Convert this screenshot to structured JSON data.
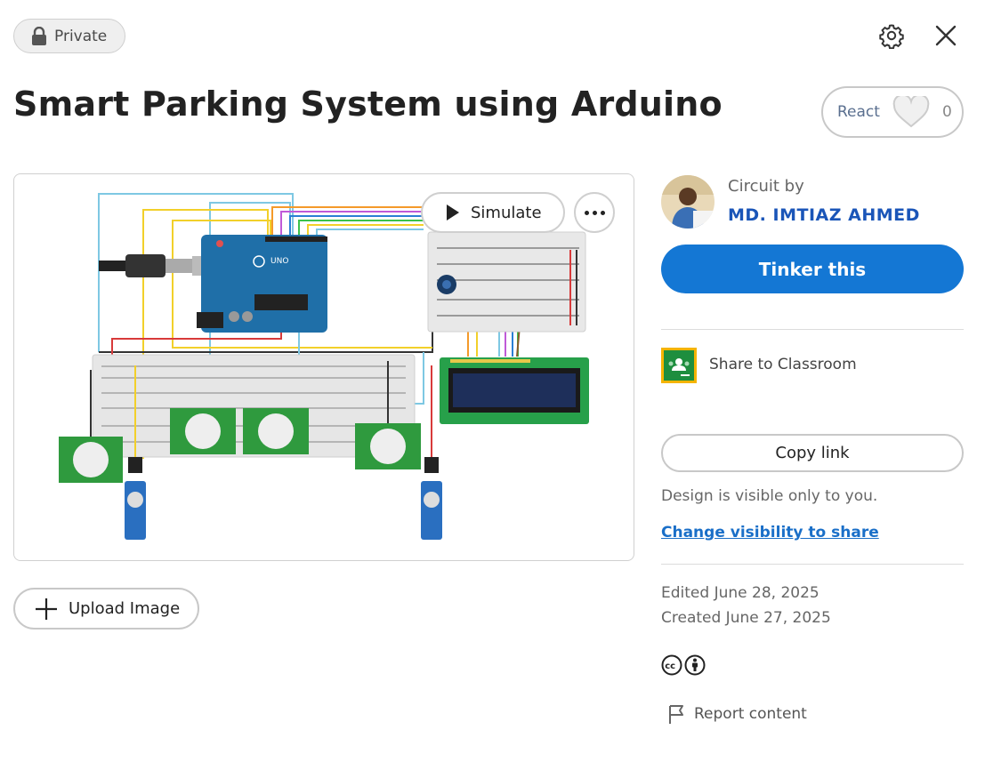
{
  "header": {
    "visibility_label": "Private",
    "title": "Smart Parking System using Arduino"
  },
  "reactions": {
    "label": "React",
    "count": "0"
  },
  "preview": {
    "simulate_label": "Simulate"
  },
  "upload": {
    "label": "Upload Image"
  },
  "sidebar": {
    "circuit_by_label": "Circuit by",
    "author_name": "MD. IMTIAZ AHMED",
    "tinker_label": "Tinker this",
    "share_classroom_label": "Share to Classroom",
    "copy_link_label": "Copy link",
    "visibility_note": "Design is visible only to you.",
    "change_visibility_label": "Change visibility to share",
    "edited": "Edited June 28, 2025",
    "created": "Created June 27, 2025",
    "report_label": "Report content"
  },
  "icons": {
    "lock": "lock-icon",
    "settings": "gear-icon",
    "close": "close-icon",
    "heart": "heart-icon",
    "play": "play-icon",
    "more": "more-options-icon",
    "plus": "plus-icon",
    "classroom": "google-classroom-icon",
    "cc": "creative-commons-icon",
    "attribution": "attribution-icon",
    "flag": "flag-icon"
  },
  "colors": {
    "accent": "#1477d4",
    "link": "#1a55b8",
    "badge_bg": "#efefef"
  }
}
